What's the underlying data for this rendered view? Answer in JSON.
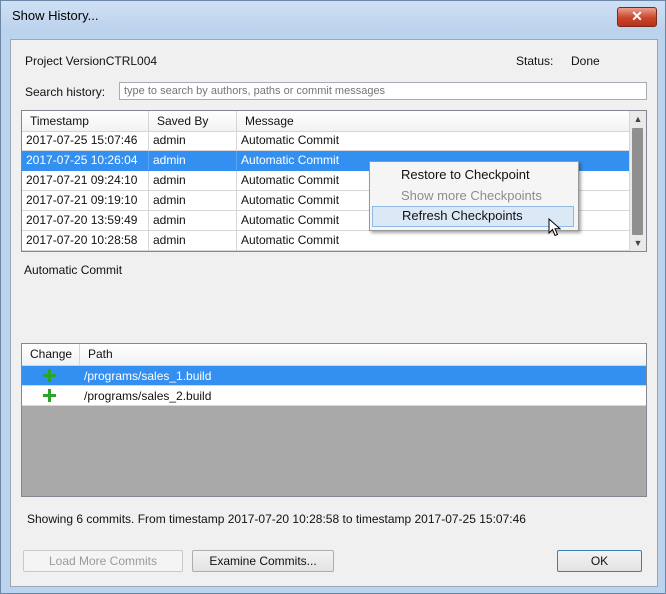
{
  "window": {
    "title": "Show History...",
    "close_glyph": "✕"
  },
  "header": {
    "project_label": "Project VersionCTRL004",
    "status_label": "Status:",
    "status_value": "Done"
  },
  "search": {
    "label": "Search history:",
    "placeholder": "type to search by authors, paths or commit messages",
    "value": ""
  },
  "commits": {
    "columns": [
      "Timestamp",
      "Saved By",
      "Message"
    ],
    "rows": [
      {
        "timestamp": "2017-07-25 15:07:46",
        "saved_by": "admin",
        "message": "Automatic Commit",
        "selected": false
      },
      {
        "timestamp": "2017-07-25 10:26:04",
        "saved_by": "admin",
        "message": "Automatic Commit",
        "selected": true
      },
      {
        "timestamp": "2017-07-21 09:24:10",
        "saved_by": "admin",
        "message": "Automatic Commit",
        "selected": false
      },
      {
        "timestamp": "2017-07-21 09:19:10",
        "saved_by": "admin",
        "message": "Automatic Commit",
        "selected": false
      },
      {
        "timestamp": "2017-07-20 13:59:49",
        "saved_by": "admin",
        "message": "Automatic Commit",
        "selected": false
      },
      {
        "timestamp": "2017-07-20 10:28:58",
        "saved_by": "admin",
        "message": "Automatic Commit",
        "selected": false
      }
    ],
    "scroll_up_glyph": "▲",
    "scroll_down_glyph": "▼"
  },
  "message_panel": {
    "text": "Automatic Commit"
  },
  "changes": {
    "columns": [
      "Change",
      "Path"
    ],
    "rows": [
      {
        "change_icon": "plus-icon",
        "path": "/programs/sales_1.build",
        "selected": true
      },
      {
        "change_icon": "plus-icon",
        "path": "/programs/sales_2.build",
        "selected": false
      }
    ]
  },
  "summary": {
    "text": "Showing 6 commits. From timestamp 2017-07-20 10:28:58  to timestamp  2017-07-25 15:07:46"
  },
  "buttons": {
    "load_more": "Load More Commits",
    "examine": "Examine Commits...",
    "ok": "OK"
  },
  "context_menu": {
    "items": [
      {
        "label": "Restore to Checkpoint",
        "enabled": true,
        "hover": false
      },
      {
        "label": "Show more Checkpoints",
        "enabled": false,
        "hover": false
      },
      {
        "label": "Refresh Checkpoints",
        "enabled": true,
        "hover": true
      }
    ]
  },
  "colors": {
    "selection": "#3390f0",
    "title_bar": "#bcd2ec",
    "close_button": "#c9452a",
    "add_icon": "#2aa52a",
    "empty_list_area": "#a9a9a9"
  }
}
